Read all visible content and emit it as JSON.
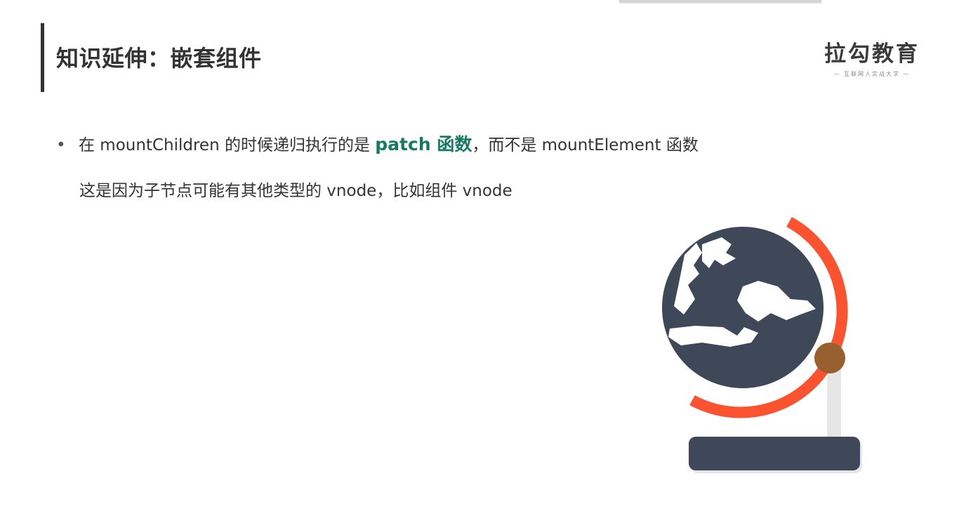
{
  "slide": {
    "title": "知识延伸：嵌套组件",
    "brand": {
      "name": "拉勾教育",
      "tagline": "— 互联网人实战大学 —"
    }
  },
  "content": {
    "bullet": {
      "before": "在 mountChildren 的时候递归执行的是 ",
      "highlight": "patch 函数",
      "after": "，而不是 mountElement 函数"
    },
    "line2": "这是因为子节点可能有其他类型的 vnode，比如组件 vnode"
  },
  "colors": {
    "highlight": "#167a62",
    "globe_body": "#3e4858",
    "globe_arc": "#fb5330",
    "pivot": "#98602f",
    "stand_base": "#3e4858"
  },
  "icons": {
    "illustration": "globe-icon"
  }
}
